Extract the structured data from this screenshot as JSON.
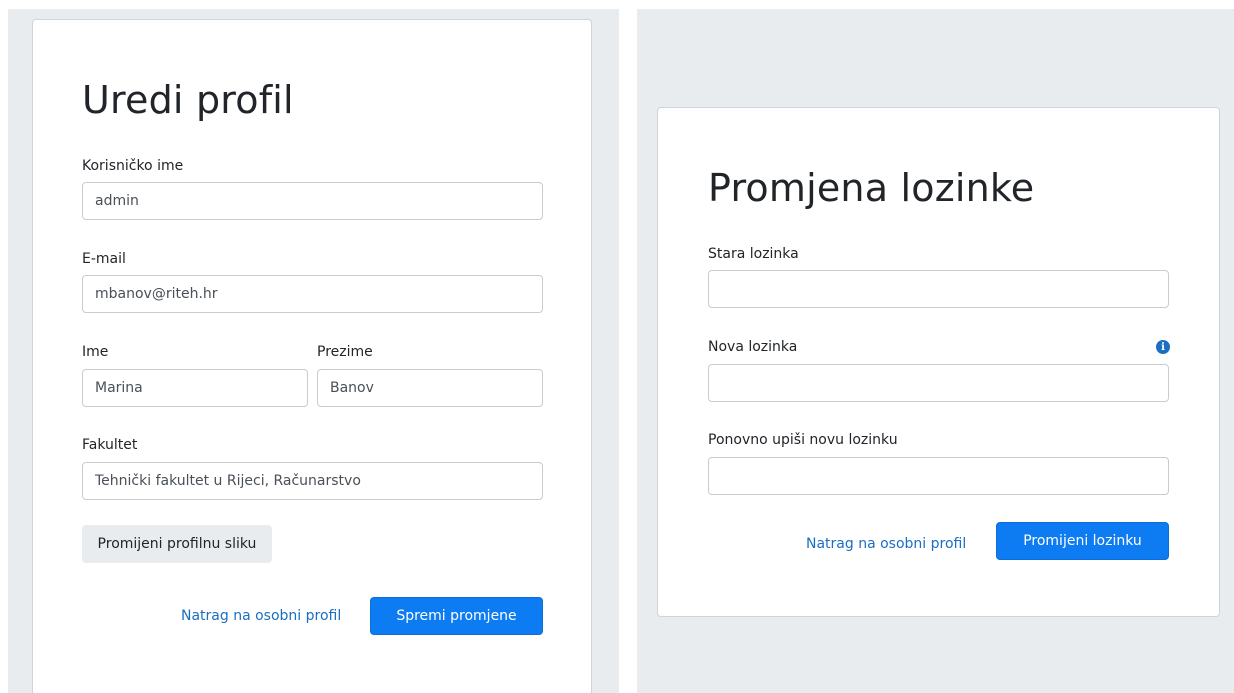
{
  "edit_profile": {
    "title": "Uredi profil",
    "username_label": "Korisničko ime",
    "username_value": "admin",
    "email_label": "E-mail",
    "email_value": "mbanov@riteh.hr",
    "first_name_label": "Ime",
    "first_name_value": "Marina",
    "last_name_label": "Prezime",
    "last_name_value": "Banov",
    "faculty_label": "Fakultet",
    "faculty_value": "Tehnički fakultet u Rijeci, Računarstvo",
    "change_picture_label": "Promijeni profilnu sliku",
    "back_link_label": "Natrag na osobni profil",
    "save_label": "Spremi promjene"
  },
  "change_password": {
    "title": "Promjena lozinke",
    "old_password_label": "Stara lozinka",
    "new_password_label": "Nova lozinka",
    "new_password_info_icon": "info-circle-icon",
    "repeat_password_label": "Ponovno upiši novu lozinku",
    "back_link_label": "Natrag na osobni profil",
    "submit_label": "Promijeni lozinku"
  },
  "colors": {
    "primary": "#0d7bf2",
    "link": "#1b6ec2",
    "panel_background": "#e9ecef"
  }
}
